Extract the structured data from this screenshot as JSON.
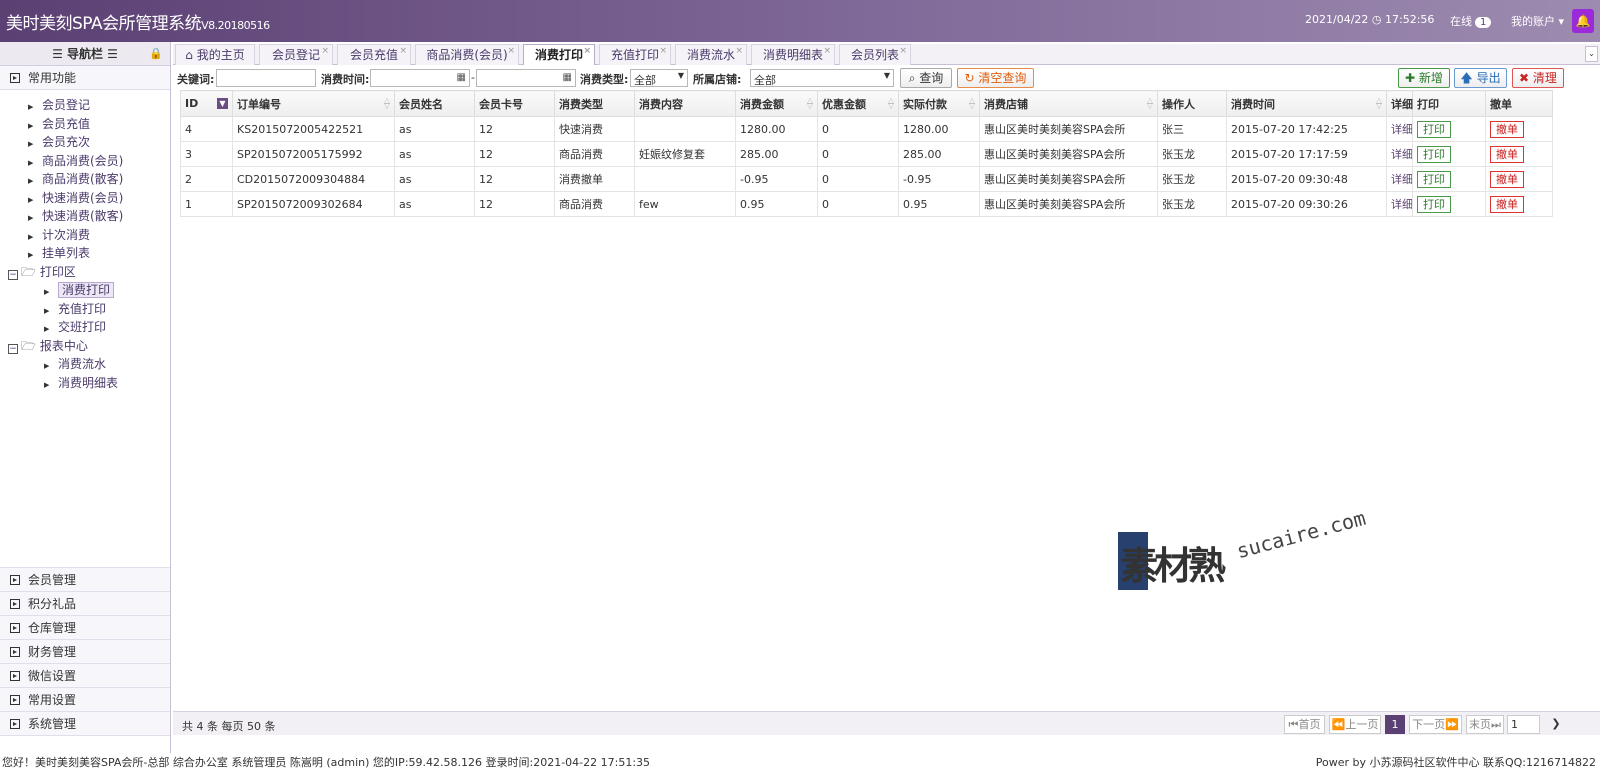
{
  "header": {
    "title": "美时美刻SPA会所管理系统",
    "version": "V8.20180516",
    "datetime": "2021/04/22 ◷ 17:52:56",
    "online_label": "在线",
    "online_count": "1",
    "account": "我的账户 ▾",
    "accent": "#5b4073"
  },
  "sidebar": {
    "title": "☰ 导航栏 ☰",
    "top_section": "常用功能",
    "tree": [
      {
        "label": "会员登记"
      },
      {
        "label": "会员充值"
      },
      {
        "label": "会员充次"
      },
      {
        "label": "商品消费(会员)"
      },
      {
        "label": "商品消费(散客)"
      },
      {
        "label": "快速消费(会员)"
      },
      {
        "label": "快速消费(散客)"
      },
      {
        "label": "计次消费"
      },
      {
        "label": "挂单列表"
      },
      {
        "label": "打印区"
      },
      {
        "label": "消费打印"
      },
      {
        "label": "充值打印"
      },
      {
        "label": "交班打印"
      },
      {
        "label": "报表中心"
      },
      {
        "label": "消费流水"
      },
      {
        "label": "消费明细表"
      }
    ],
    "bottom_sections": [
      "会员管理",
      "积分礼品",
      "仓库管理",
      "财务管理",
      "微信设置",
      "常用设置",
      "系统管理"
    ]
  },
  "tabs": [
    {
      "label": "我的主页"
    },
    {
      "label": "会员登记"
    },
    {
      "label": "会员充值"
    },
    {
      "label": "商品消费(会员)"
    },
    {
      "label": "消费打印"
    },
    {
      "label": "充值打印"
    },
    {
      "label": "消费流水"
    },
    {
      "label": "消费明细表"
    },
    {
      "label": "会员列表"
    }
  ],
  "toolbar": {
    "keyword_label": "关键词:",
    "keyword_value": "",
    "time_label": "消费时间:",
    "time_sep": "-",
    "type_label": "消费类型:",
    "type_value": "全部",
    "store_label": "所属店铺:",
    "store_value": "全部",
    "search_btn": "查询",
    "clear_btn": "清空查询",
    "add_btn": "新增",
    "export_btn": "导出",
    "clean_btn": "清理"
  },
  "table": {
    "columns": [
      "ID",
      "订单编号",
      "会员姓名",
      "会员卡号",
      "消费类型",
      "消费内容",
      "消费金额",
      "优惠金额",
      "实际付款",
      "消费店铺",
      "操作人",
      "消费时间",
      "详细",
      "打印",
      "撤单"
    ],
    "rows": [
      {
        "id": "4",
        "order": "KS2015072005422521",
        "name": "as",
        "card": "12",
        "type": "快速消费",
        "content": "",
        "amount": "1280.00",
        "discount": "0",
        "paid": "1280.00",
        "store": "惠山区美时美刻美容SPA会所",
        "operator": "张三",
        "time": "2015-07-20 17:42:25",
        "detail": "详细",
        "print": "打印",
        "cancel": "撤单"
      },
      {
        "id": "3",
        "order": "SP2015072005175992",
        "name": "as",
        "card": "12",
        "type": "商品消费",
        "content": "妊娠纹修复套",
        "amount": "285.00",
        "discount": "0",
        "paid": "285.00",
        "store": "惠山区美时美刻美容SPA会所",
        "operator": "张玉龙",
        "time": "2015-07-20 17:17:59",
        "detail": "详细",
        "print": "打印",
        "cancel": "撤单"
      },
      {
        "id": "2",
        "order": "CD2015072009304884",
        "name": "as",
        "card": "12",
        "type": "消费撤单",
        "content": "",
        "amount": "-0.95",
        "discount": "0",
        "paid": "-0.95",
        "store": "惠山区美时美刻美容SPA会所",
        "operator": "张玉龙",
        "time": "2015-07-20 09:30:48",
        "detail": "详细",
        "print": "打印",
        "cancel": "撤单"
      },
      {
        "id": "1",
        "order": "SP2015072009302684",
        "name": "as",
        "card": "12",
        "type": "商品消费",
        "content": "few",
        "amount": "0.95",
        "discount": "0",
        "paid": "0.95",
        "store": "惠山区美时美刻美容SPA会所",
        "operator": "张玉龙",
        "time": "2015-07-20 09:30:26",
        "detail": "详细",
        "print": "打印",
        "cancel": "撤单"
      }
    ]
  },
  "pager": {
    "info": "共 4 条 每页 50 条",
    "first": "首页",
    "prev": "上一页",
    "current": "1",
    "next": "下一页",
    "last": "末页",
    "page_input": "1"
  },
  "status": {
    "left": "您好！美时美刻美容SPA会所-总部 综合办公室 系统管理员 陈嵩明 (admin) 您的IP:59.42.58.126 登录时间:2021-04-22 17:51:35",
    "right": "Power by 小苏源码社区软件中心 联系QQ:1216714822"
  },
  "watermark": {
    "text": "素材熟",
    "sub": "sucaire.com"
  }
}
